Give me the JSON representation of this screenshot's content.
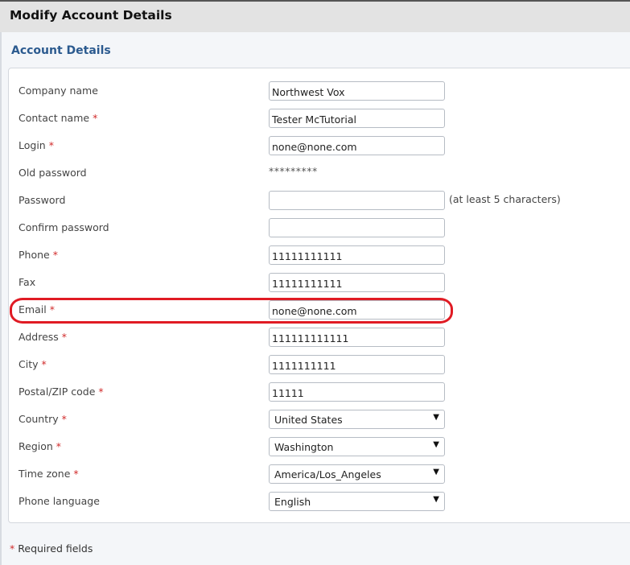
{
  "header": {
    "title": "Modify Account Details"
  },
  "section": {
    "title": "Account Details"
  },
  "required_marker": "*",
  "fields": [
    {
      "label": "Company name",
      "value": "Northwest Vox"
    },
    {
      "label": "Contact name",
      "value": "Tester McTutorial"
    },
    {
      "label": "Login",
      "value": "none@none.com"
    },
    {
      "label": "Old password",
      "value": "*********"
    },
    {
      "label": "Password",
      "value": "",
      "hint": "(at least 5 characters)"
    },
    {
      "label": "Confirm password",
      "value": ""
    },
    {
      "label": "Phone",
      "value": "11111111111"
    },
    {
      "label": "Fax",
      "value": "11111111111"
    },
    {
      "label": "Email",
      "value": "none@none.com"
    },
    {
      "label": "Address",
      "value": "111111111111"
    },
    {
      "label": "City",
      "value": "1111111111"
    },
    {
      "label": "Postal/ZIP code",
      "value": "11111"
    },
    {
      "label": "Country",
      "value": "United States"
    },
    {
      "label": "Region",
      "value": "Washington"
    },
    {
      "label": "Time zone",
      "value": "America/Los_Angeles"
    },
    {
      "label": "Phone language",
      "value": "English"
    }
  ],
  "caret_glyph": "▼",
  "footer": {
    "text": "Required fields"
  },
  "colors": {
    "section_title": "#2b5a8f",
    "required": "#d12b2b",
    "highlight": "#e01b24"
  }
}
